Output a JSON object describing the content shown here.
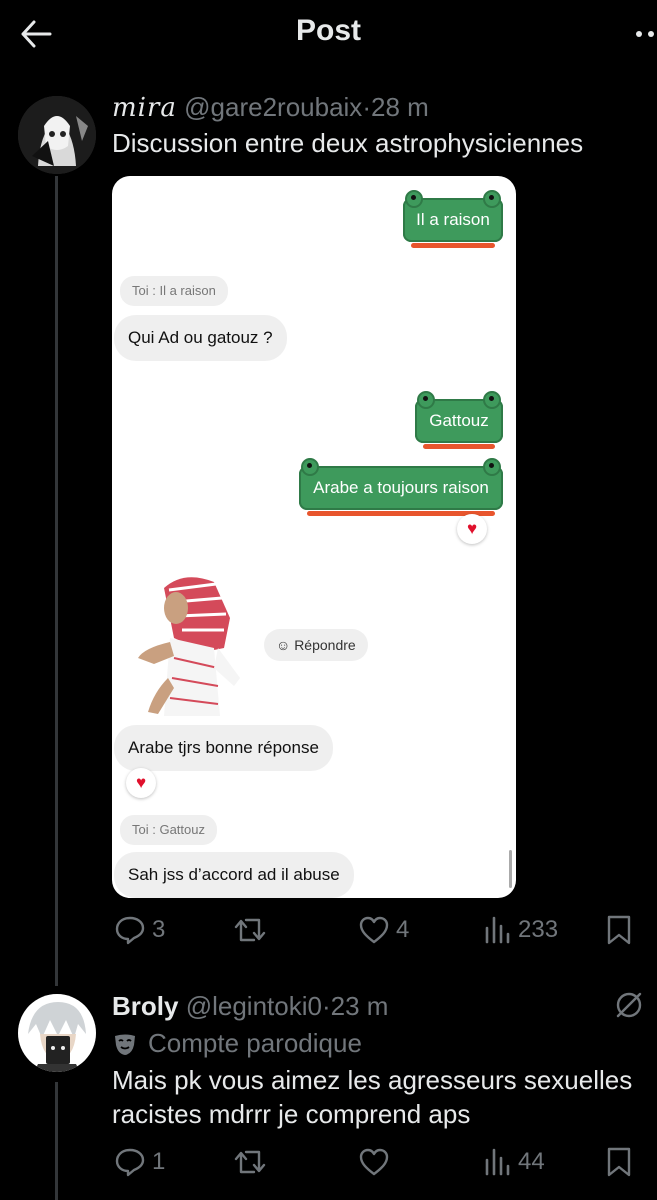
{
  "header": {
    "title": "Post"
  },
  "post": {
    "author_name": "mira",
    "handle": "@gare2roubaix",
    "time": "28 m",
    "separator": "·",
    "text": "Discussion entre deux astrophysiciennes",
    "embedded": {
      "msg_out_1": "Il a raison",
      "quote_1": "Toi : Il a raison",
      "msg_in_1": "Qui Ad ou gatouz ?",
      "msg_out_2": "Gattouz",
      "msg_out_3": "Arabe a toujours raison",
      "reply_label": "Répondre",
      "msg_in_2": "Arabe tjrs bonne réponse",
      "quote_2": "Toi : Gattouz",
      "msg_in_3": "Sah jss d’accord ad il abuse"
    },
    "actions": {
      "replies": "3",
      "likes": "4",
      "views": "233"
    }
  },
  "reply": {
    "author_name": "Broly",
    "handle": "@legintoki0",
    "time": "23 m",
    "separator": "·",
    "parody_label": "Compte parodique",
    "text_line1": "Mais pk vous aimez les agresseurs sexuelles",
    "text_line2": "racistes mdrrr je comprend aps",
    "actions": {
      "replies": "1",
      "views": "44"
    }
  },
  "colors": {
    "background": "#000000",
    "text": "#e7e9ea",
    "muted": "#71767b",
    "bubble_green": "#3e9a5c",
    "heart": "#e0102c"
  },
  "icons": [
    "back-arrow-icon",
    "more-icon",
    "reply-icon",
    "retweet-icon",
    "like-icon",
    "views-icon",
    "bookmark-icon",
    "grok-icon",
    "parody-mask-icon",
    "heart-reaction-icon",
    "smiley-icon"
  ]
}
